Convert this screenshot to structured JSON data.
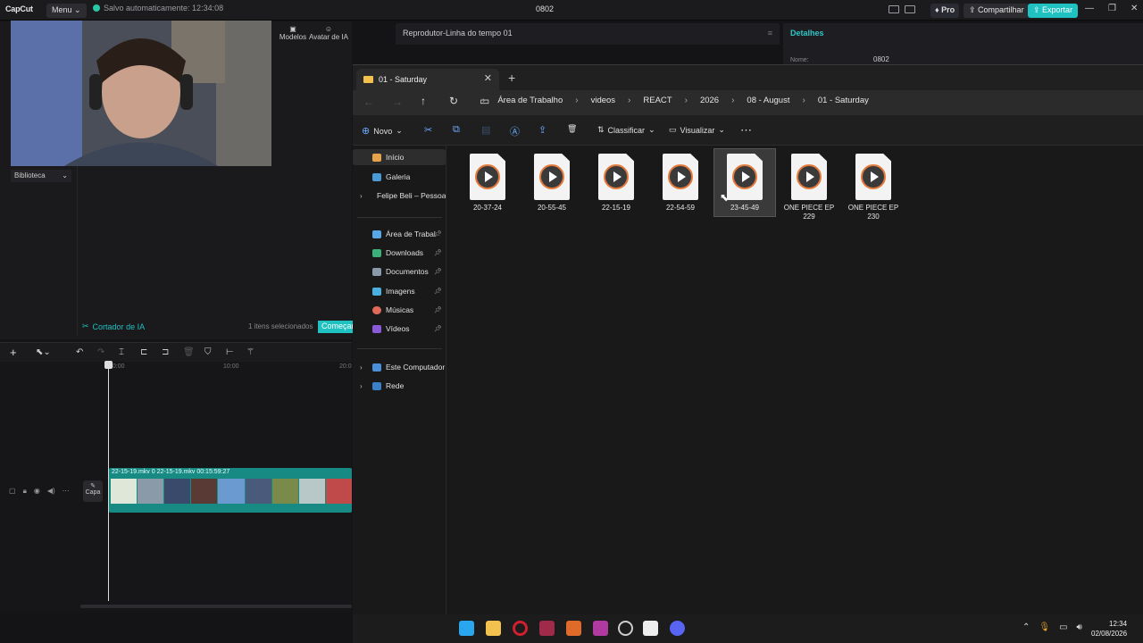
{
  "capcut": {
    "logo": "CapCut",
    "menu_label": "Menu",
    "autosave": "Salvo automaticamente: 12:34:08",
    "project_name": "0802",
    "pro_label": "Pro",
    "share_label": "Compartilhar",
    "export_label": "Exportar",
    "accent_color": "#1fc1c1",
    "tools": {
      "models": "Modelos",
      "avatar": "Avatar de IA"
    },
    "library_label": "Biblioteca",
    "ai_cutter": "Cortador de IA",
    "selected_count": "1 itens selecionados",
    "start_label": "Começar",
    "player_title": "Reprodutor-Linha do tempo 01",
    "details_title": "Detalhes",
    "details_name_label": "Nome:",
    "details_name_value": "0802",
    "ruler": [
      "00:00",
      "10:00",
      "20:0"
    ],
    "clip_label": "22-15-19.mkv  0  22-15-19.mkv  00:15:59:27",
    "cover_label": "Capa"
  },
  "explorer": {
    "tab_title": "01 - Saturday",
    "breadcrumbs": [
      "Área de Trabalho",
      "videos",
      "REACT",
      "2026",
      "08 - August",
      "01 - Saturday"
    ],
    "commands": {
      "new": "Novo",
      "sort": "Classificar",
      "view": "Visualizar"
    },
    "sidebar": [
      {
        "label": "Início",
        "icon": "home-icon"
      },
      {
        "label": "Galeria",
        "icon": "gallery-icon"
      },
      {
        "label": "Felipe Beli – Pessoa",
        "icon": "cloud-icon"
      },
      {
        "label": "Área de Trabalho",
        "icon": "desktop-icon",
        "pinned": true
      },
      {
        "label": "Downloads",
        "icon": "download-icon",
        "pinned": true
      },
      {
        "label": "Documentos",
        "icon": "documents-icon",
        "pinned": true
      },
      {
        "label": "Imagens",
        "icon": "images-icon",
        "pinned": true
      },
      {
        "label": "Músicas",
        "icon": "music-icon",
        "pinned": true
      },
      {
        "label": "Vídeos",
        "icon": "videos-icon",
        "pinned": true
      },
      {
        "label": "Este Computador",
        "icon": "computer-icon"
      },
      {
        "label": "Rede",
        "icon": "network-icon"
      }
    ],
    "files": [
      {
        "name": "20-37-24"
      },
      {
        "name": "20-55-45"
      },
      {
        "name": "22-15-19"
      },
      {
        "name": "22-54-59"
      },
      {
        "name": "23-45-49",
        "selected": true
      },
      {
        "name": "ONE PIECE EP 229"
      },
      {
        "name": "ONE PIECE EP 230"
      }
    ]
  },
  "taskbar": {
    "time": "12:34",
    "date": "02/08/2026"
  }
}
